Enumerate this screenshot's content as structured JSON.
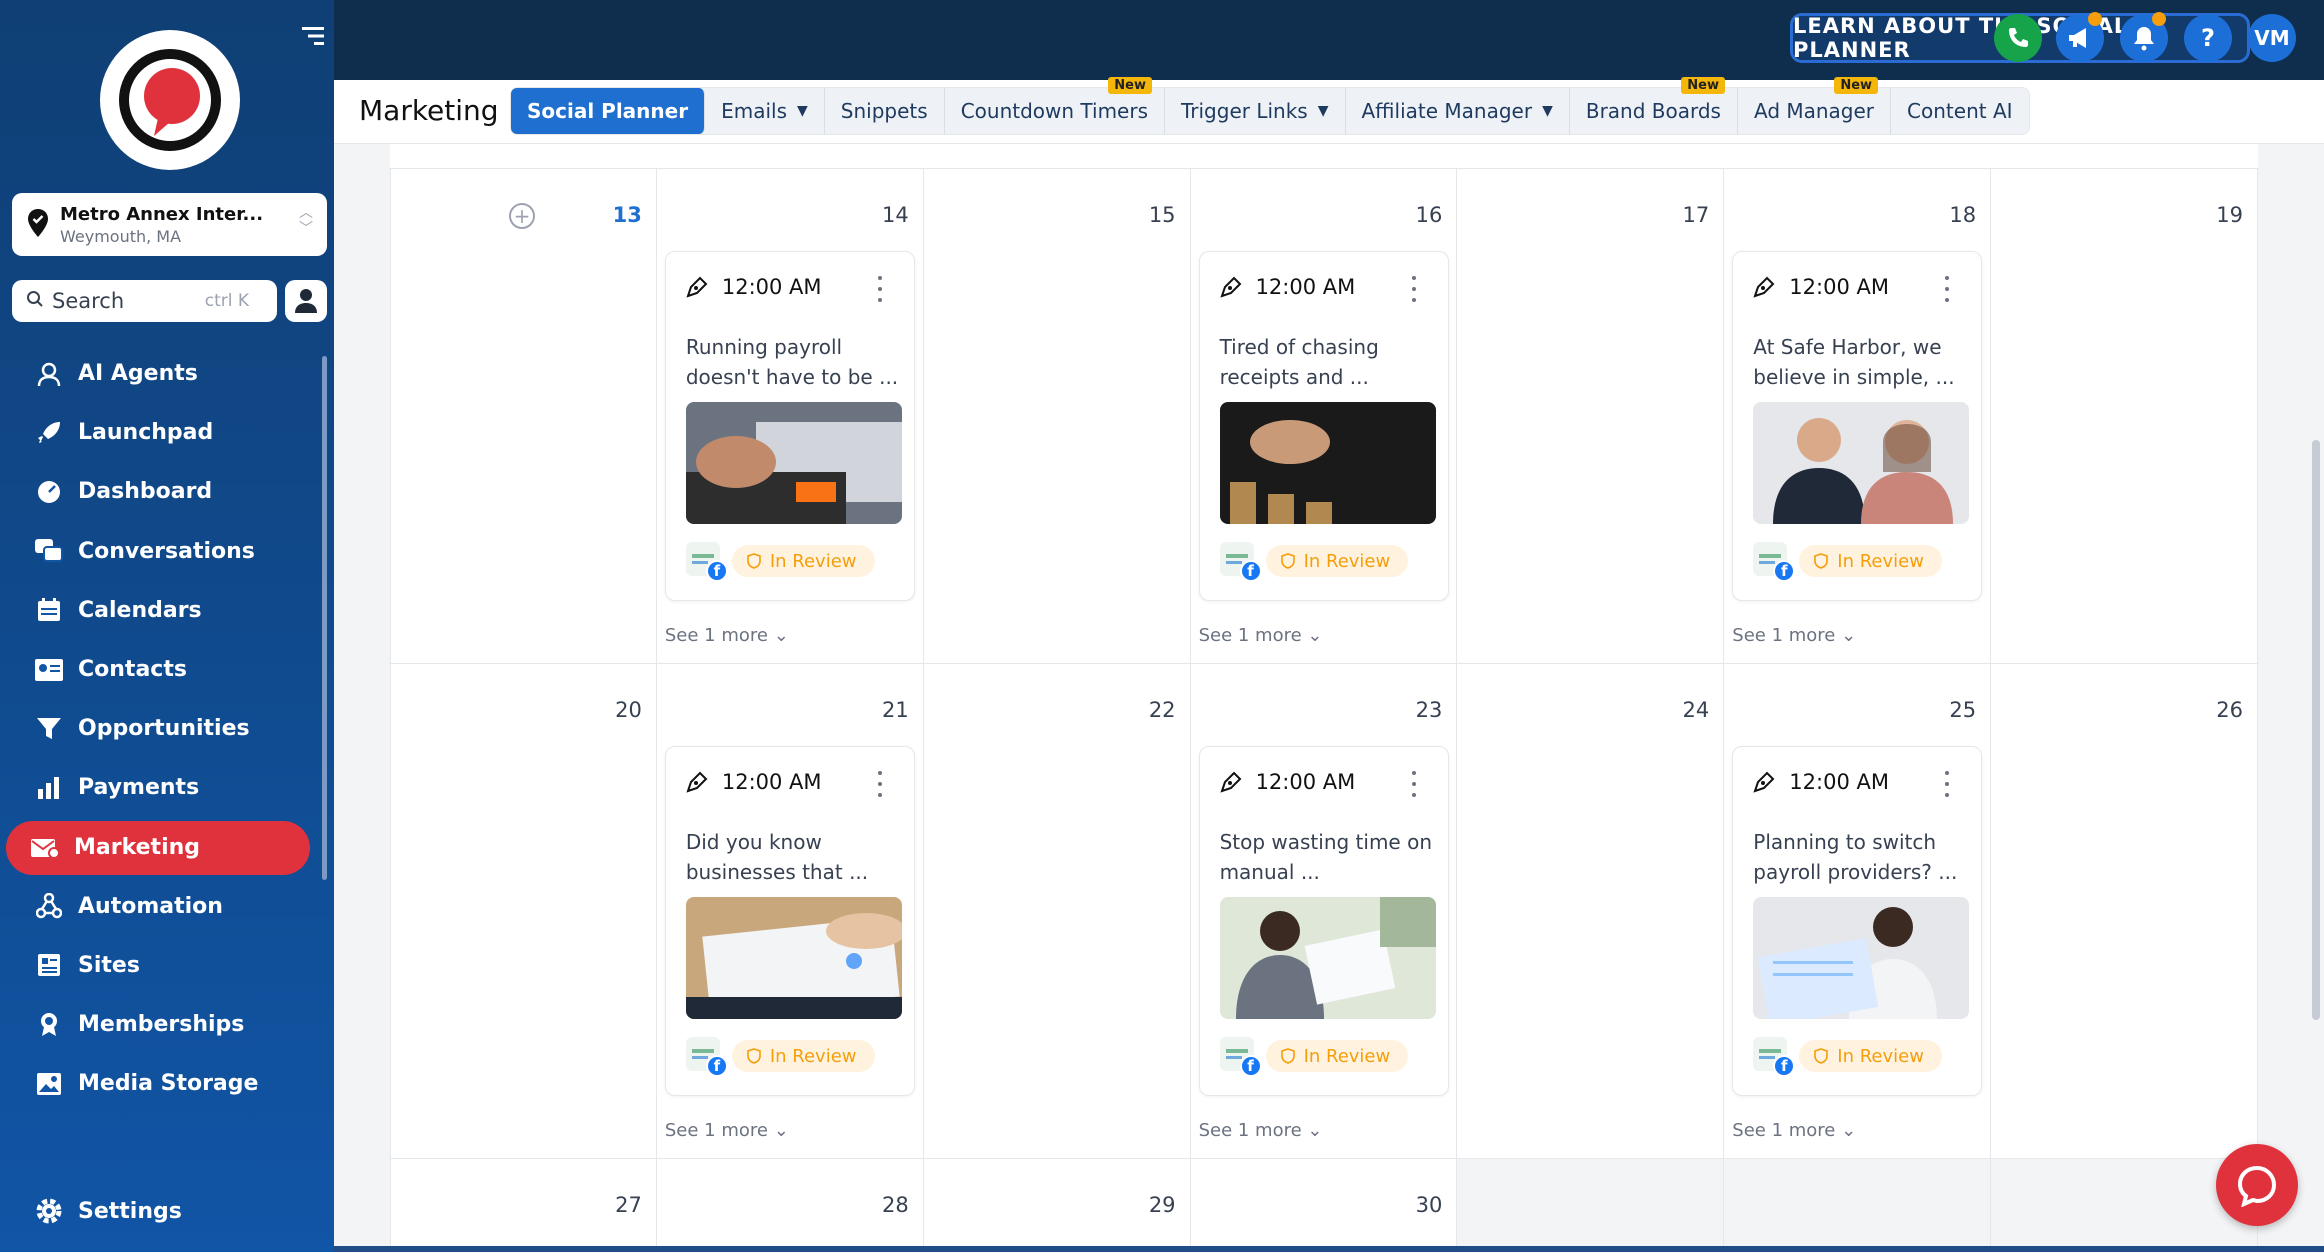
{
  "sidebar": {
    "location": {
      "name": "Metro Annex Inter...",
      "sub": "Weymouth, MA"
    },
    "search": {
      "label": "Search",
      "hint": "ctrl K"
    },
    "items": [
      {
        "label": "AI Agents",
        "icon": "ai-agent-icon"
      },
      {
        "label": "Launchpad",
        "icon": "rocket-icon"
      },
      {
        "label": "Dashboard",
        "icon": "gauge-icon"
      },
      {
        "label": "Conversations",
        "icon": "chat-bubbles-icon"
      },
      {
        "label": "Calendars",
        "icon": "calendar-icon"
      },
      {
        "label": "Contacts",
        "icon": "contact-card-icon"
      },
      {
        "label": "Opportunities",
        "icon": "funnel-icon"
      },
      {
        "label": "Payments",
        "icon": "payments-icon"
      },
      {
        "label": "Marketing",
        "icon": "marketing-icon",
        "active": true
      },
      {
        "label": "Automation",
        "icon": "automation-icon"
      },
      {
        "label": "Sites",
        "icon": "sites-icon"
      },
      {
        "label": "Memberships",
        "icon": "membership-icon"
      },
      {
        "label": "Media Storage",
        "icon": "image-icon"
      }
    ],
    "settings": "Settings"
  },
  "topbar": {
    "learn_button": "LEARN ABOUT THE SOCIAL PLANNER",
    "avatar": "VM",
    "help": "?"
  },
  "subnav": {
    "title": "Marketing",
    "tabs": [
      {
        "label": "Social Planner",
        "active": true
      },
      {
        "label": "Emails",
        "dropdown": true
      },
      {
        "label": "Snippets"
      },
      {
        "label": "Countdown Timers",
        "badge": "New"
      },
      {
        "label": "Trigger Links",
        "dropdown": true
      },
      {
        "label": "Affiliate Manager",
        "dropdown": true
      },
      {
        "label": "Brand Boards",
        "badge": "New"
      },
      {
        "label": "Ad Manager",
        "badge": "New"
      },
      {
        "label": "Content AI"
      }
    ]
  },
  "calendar": {
    "weeks": [
      {
        "days": [
          {
            "num": "13",
            "today": true
          },
          {
            "num": "14",
            "post": {
              "time": "12:00 AM",
              "text": "Running payroll doesn't have to be ...",
              "status": "In Review",
              "more": "See 1 more"
            }
          },
          {
            "num": "15"
          },
          {
            "num": "16",
            "post": {
              "time": "12:00 AM",
              "text": "Tired of chasing receipts and ...",
              "status": "In Review",
              "more": "See 1 more"
            }
          },
          {
            "num": "17"
          },
          {
            "num": "18",
            "post": {
              "time": "12:00 AM",
              "text": "At Safe Harbor, we believe in simple, ...",
              "status": "In Review",
              "more": "See 1 more"
            }
          },
          {
            "num": "19"
          }
        ]
      },
      {
        "days": [
          {
            "num": "20"
          },
          {
            "num": "21",
            "post": {
              "time": "12:00 AM",
              "text": "Did you know businesses that ...",
              "status": "In Review",
              "more": "See 1 more"
            }
          },
          {
            "num": "22"
          },
          {
            "num": "23",
            "post": {
              "time": "12:00 AM",
              "text": "Stop wasting time on manual ...",
              "status": "In Review",
              "more": "See 1 more"
            }
          },
          {
            "num": "24"
          },
          {
            "num": "25",
            "post": {
              "time": "12:00 AM",
              "text": "Planning to switch payroll providers? ...",
              "status": "In Review",
              "more": "See 1 more"
            }
          },
          {
            "num": "26"
          }
        ]
      },
      {
        "days": [
          {
            "num": "27"
          },
          {
            "num": "28"
          },
          {
            "num": "29"
          },
          {
            "num": "30"
          },
          {
            "num": ""
          },
          {
            "num": ""
          },
          {
            "num": ""
          }
        ]
      }
    ]
  },
  "colors": {
    "sidebar": "#1155a6",
    "topbar": "#0f2e4d",
    "accent_red": "#e0323d",
    "tab_active": "#1f6fd1",
    "status_orange": "#f59e0b"
  }
}
